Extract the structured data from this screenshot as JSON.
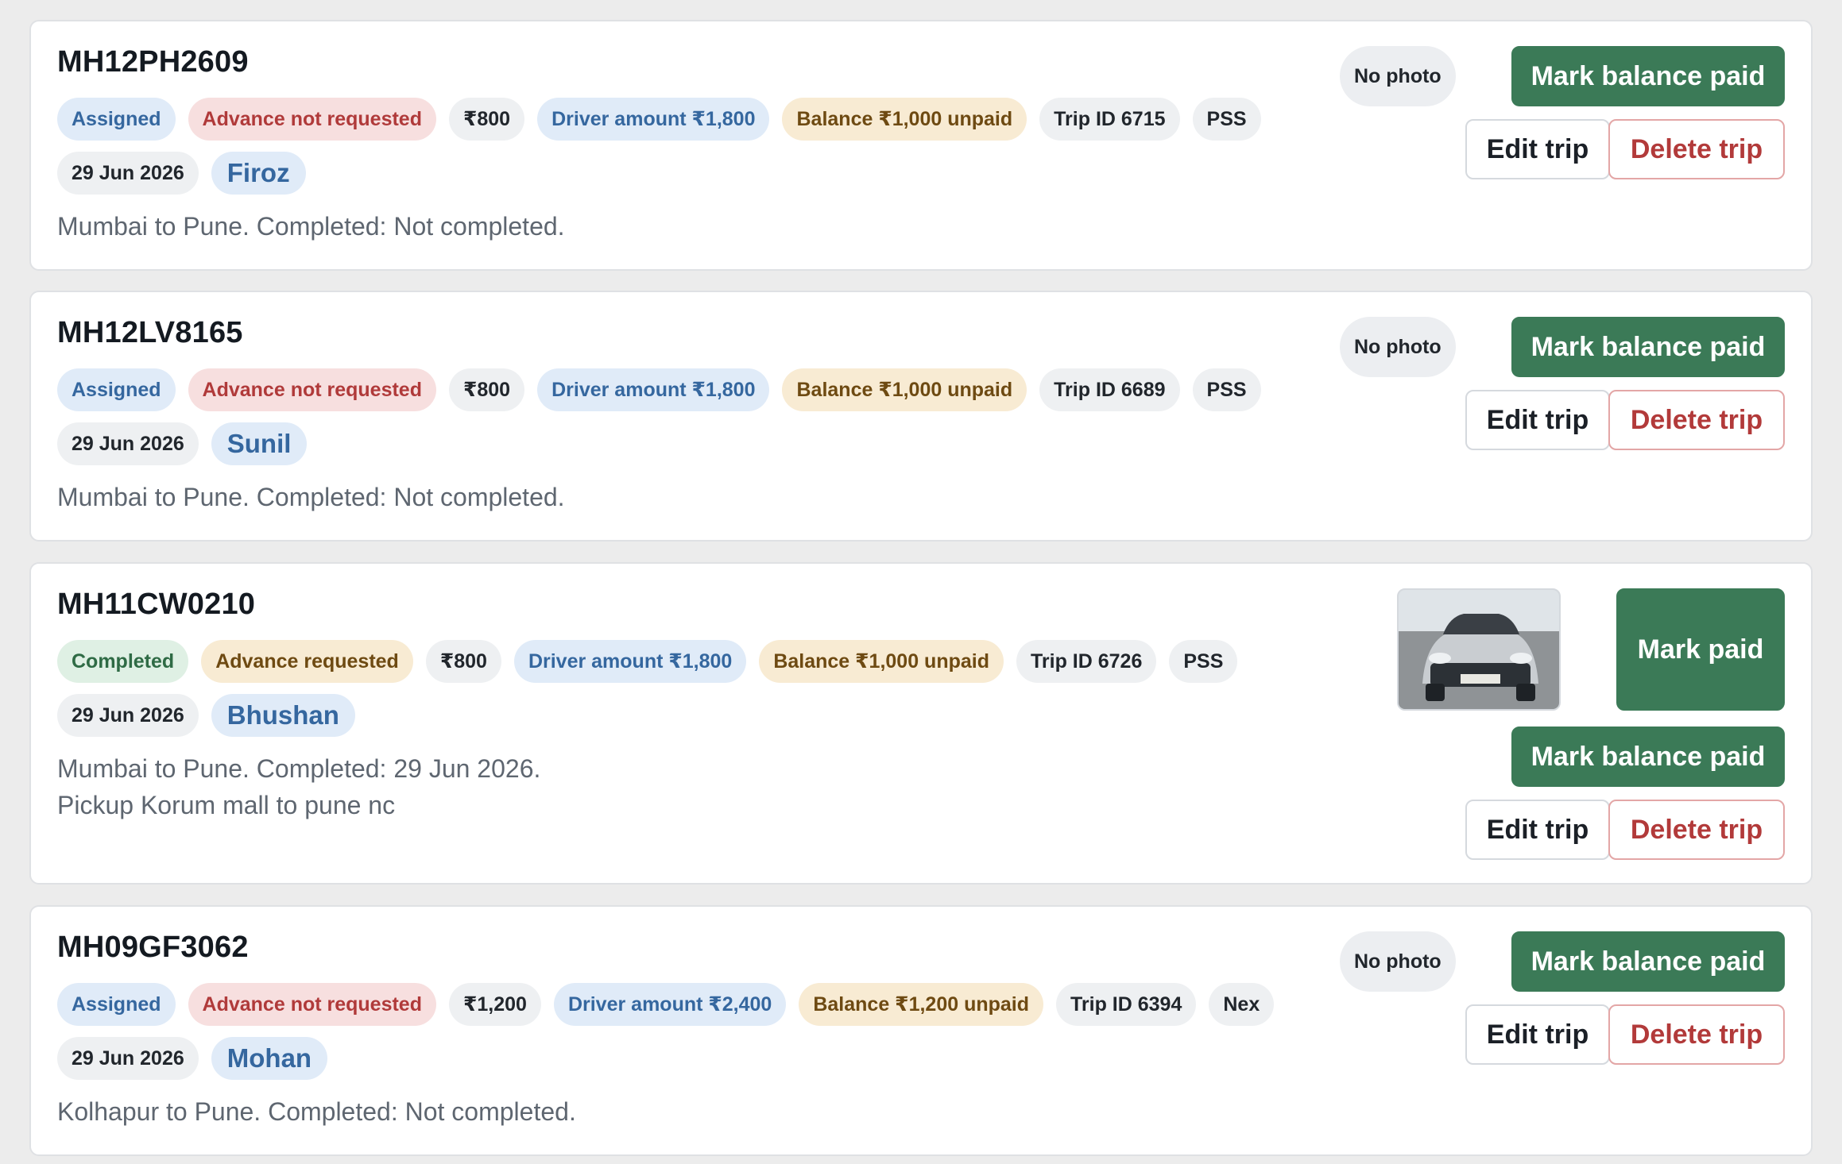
{
  "colors": {
    "primary_green": "#3b7a57",
    "danger_red": "#b23a3a",
    "chip_blue": "#35679f",
    "chip_amber": "#6e4a12",
    "page_background": "#ececec"
  },
  "trips": [
    {
      "vehicle": "MH12PH2609",
      "status": "Assigned",
      "advance": "Advance not requested",
      "fare": "₹800",
      "driver_amount": "Driver amount ₹1,800",
      "balance": "Balance ₹1,000 unpaid",
      "trip_id": "Trip ID 6715",
      "vendor": "PSS",
      "date": "29 Jun 2026",
      "driver": "Firoz",
      "description": "Mumbai to Pune. Completed: Not completed.",
      "note": "",
      "photo_label": "No photo",
      "has_photo": false,
      "actions": {
        "mark_balance_paid": "Mark balance paid",
        "edit": "Edit trip",
        "delete": "Delete trip"
      }
    },
    {
      "vehicle": "MH12LV8165",
      "status": "Assigned",
      "advance": "Advance not requested",
      "fare": "₹800",
      "driver_amount": "Driver amount ₹1,800",
      "balance": "Balance ₹1,000 unpaid",
      "trip_id": "Trip ID 6689",
      "vendor": "PSS",
      "date": "29 Jun 2026",
      "driver": "Sunil",
      "description": "Mumbai to Pune. Completed: Not completed.",
      "note": "",
      "photo_label": "No photo",
      "has_photo": false,
      "actions": {
        "mark_balance_paid": "Mark balance paid",
        "edit": "Edit trip",
        "delete": "Delete trip"
      }
    },
    {
      "vehicle": "MH11CW0210",
      "status": "Completed",
      "advance": "Advance requested",
      "fare": "₹800",
      "driver_amount": "Driver amount ₹1,800",
      "balance": "Balance ₹1,000 unpaid",
      "trip_id": "Trip ID 6726",
      "vendor": "PSS",
      "date": "29 Jun 2026",
      "driver": "Bhushan",
      "description": "Mumbai to Pune. Completed: 29 Jun 2026.",
      "note": "Pickup Korum mall to pune nc",
      "has_photo": true,
      "actions": {
        "mark_paid": "Mark paid",
        "mark_balance_paid": "Mark balance paid",
        "edit": "Edit trip",
        "delete": "Delete trip"
      }
    },
    {
      "vehicle": "MH09GF3062",
      "status": "Assigned",
      "advance": "Advance not requested",
      "fare": "₹1,200",
      "driver_amount": "Driver amount ₹2,400",
      "balance": "Balance ₹1,200 unpaid",
      "trip_id": "Trip ID 6394",
      "vendor": "Nex",
      "date": "29 Jun 2026",
      "driver": "Mohan",
      "description": "Kolhapur to Pune. Completed: Not completed.",
      "note": "",
      "photo_label": "No photo",
      "has_photo": false,
      "actions": {
        "mark_balance_paid": "Mark balance paid",
        "edit": "Edit trip",
        "delete": "Delete trip"
      }
    }
  ]
}
